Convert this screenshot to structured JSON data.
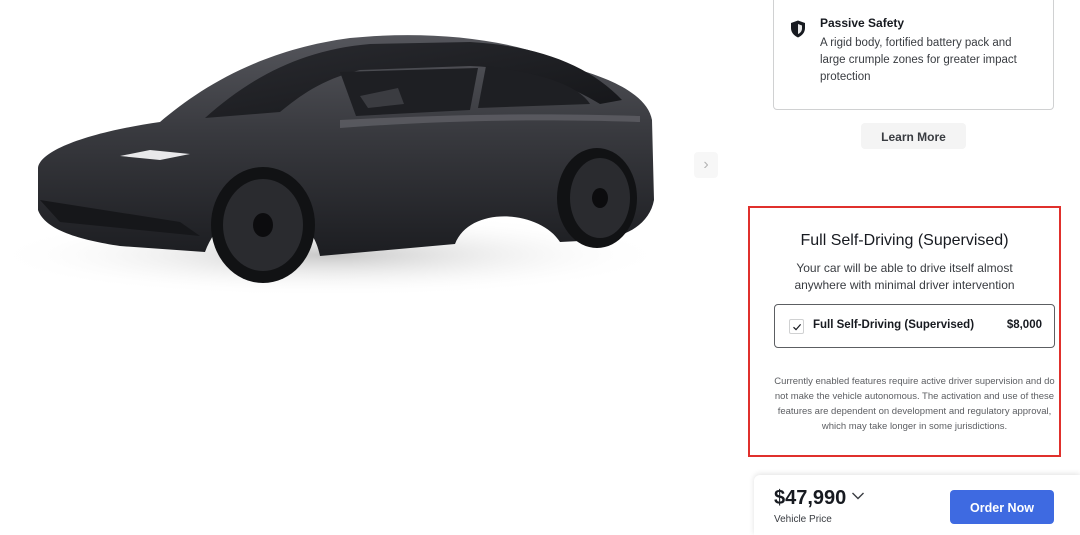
{
  "gallery": {
    "next_arrow": "›",
    "image_icon": "car-image"
  },
  "safety": {
    "icon": "shield-icon",
    "title": "Passive Safety",
    "description": "A rigid body, fortified battery pack and large crumple zones for greater impact protection"
  },
  "learn_more_label": "Learn More",
  "fsd": {
    "title": "Full Self-Driving (Supervised)",
    "subtitle": "Your car will be able to drive itself almost anywhere with minimal driver intervention",
    "option": {
      "label": "Full Self-Driving (Supervised)",
      "price": "$8,000",
      "checked": true
    },
    "disclaimer": "Currently enabled features require active driver supervision and do not make the vehicle autonomous. The activation and use of these features are dependent on development and regulatory approval, which may take longer in some jurisdictions."
  },
  "price_bar": {
    "price": "$47,990",
    "price_label": "Vehicle Price",
    "order_label": "Order Now"
  },
  "colors": {
    "accent": "#3e6ae1",
    "highlight_border": "#e0302c",
    "text": "#171a20"
  }
}
